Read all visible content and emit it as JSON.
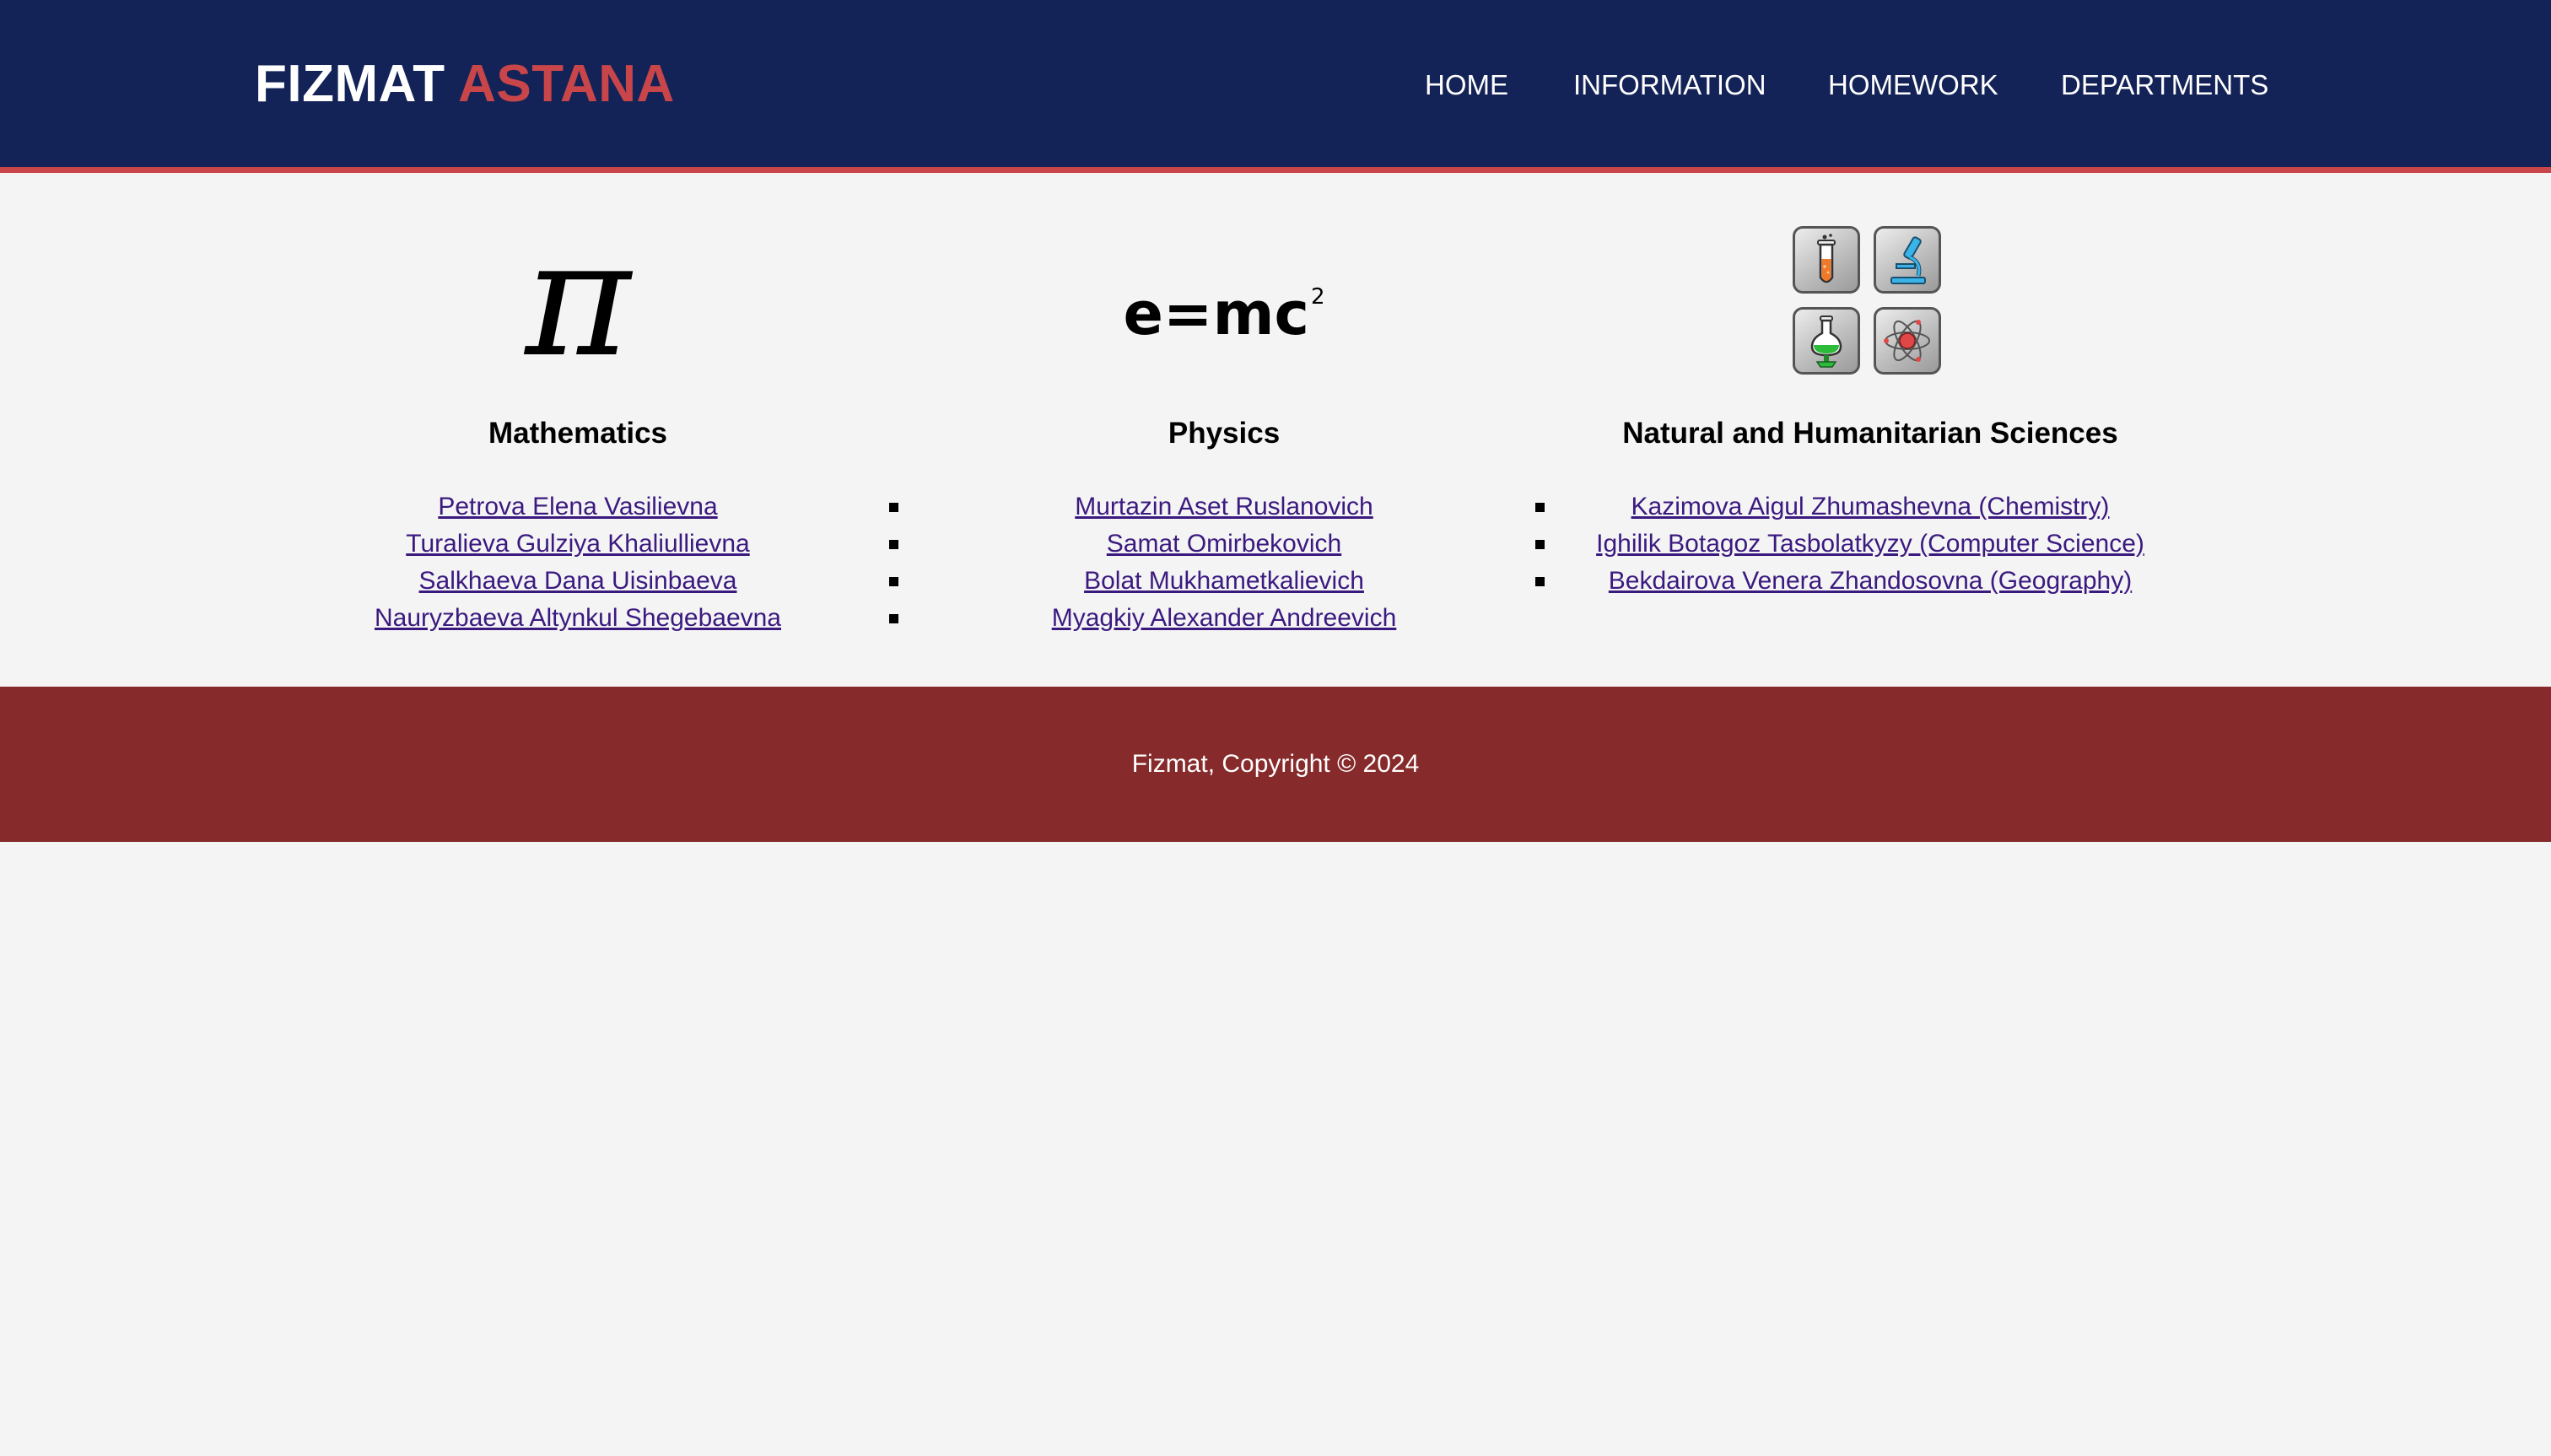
{
  "header": {
    "logo_part1": "FIZMAT",
    "logo_part2": "ASTANA",
    "nav": [
      "HOME",
      "INFORMATION",
      "HOMEWORK",
      "DEPARTMENTS"
    ]
  },
  "departments": [
    {
      "icon": "pi-icon",
      "icon_text": "π",
      "title": "Mathematics",
      "teachers": [
        "Petrova Elena Vasilievna",
        "Turalieva Gulziya Khaliullievna",
        "Salkhaeva Dana Uisinbaeva",
        "Nauryzbaeva Altynkul Shegebaevna"
      ]
    },
    {
      "icon": "emc2-icon",
      "icon_text": "e=mc",
      "icon_superscript": "2",
      "title": "Physics",
      "teachers": [
        "Murtazin Aset Ruslanovich",
        "Samat Omirbekovich",
        "Bolat Mukhametkalievich",
        "Myagkiy Alexander Andreevich"
      ]
    },
    {
      "icon": "science-tiles-icon",
      "title": "Natural and Humanitarian Sciences",
      "teachers": [
        "Kazimova Aigul Zhumashevna (Chemistry)",
        "Ighilik Botagoz Tasbolatkyzy (Computer Science)",
        "Bekdairova Venera Zhandosovna (Geography)"
      ]
    }
  ],
  "footer": {
    "text": "Fizmat, Copyright © 2024"
  },
  "colors": {
    "header_bg": "#142357",
    "accent_red": "#c8454a",
    "footer_bg": "#862a2b",
    "page_bg": "#f4f4f4",
    "link": "#3b1a80"
  }
}
